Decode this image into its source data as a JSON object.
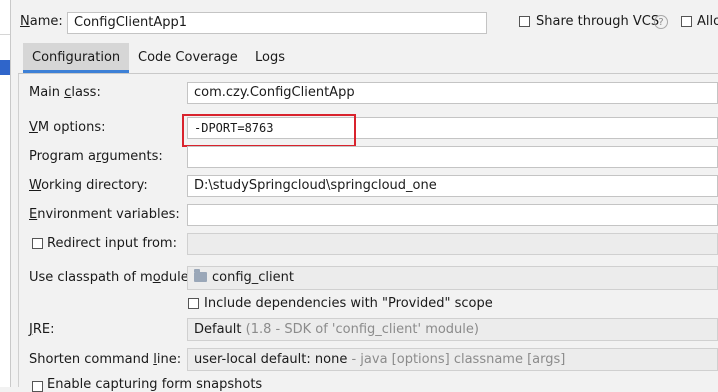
{
  "header": {
    "name_label": "Name:",
    "name_value": "ConfigClientApp1",
    "share_vcs_label": "Share through VCS",
    "share_vcs_checked": false,
    "help_glyph": "?",
    "allow_label": "Allo"
  },
  "tabs": [
    {
      "label": "Configuration",
      "active": true
    },
    {
      "label": "Code Coverage",
      "active": false
    },
    {
      "label": "Logs",
      "active": false
    }
  ],
  "form": {
    "main_class_label": "Main class:",
    "main_class_value": "com.czy.ConfigClientApp",
    "vm_options_label": "VM options:",
    "vm_options_value": "-DPORT=8763",
    "program_args_label": "Program arguments:",
    "program_args_value": "",
    "working_dir_label": "Working directory:",
    "working_dir_value": "D:\\studySpringcloud\\springcloud_one",
    "env_vars_label": "Environment variables:",
    "env_vars_value": "",
    "redirect_label": "Redirect input from:",
    "redirect_checked": false,
    "classpath_label": "Use classpath of module:",
    "classpath_value": "config_client",
    "include_deps_label": "Include dependencies with \"Provided\" scope",
    "include_deps_checked": false,
    "jre_label": "JRE:",
    "jre_value": "Default",
    "jre_hint": "(1.8 - SDK of 'config_client' module)",
    "shorten_label": "Shorten command line:",
    "shorten_value": "user-local default: none",
    "shorten_hint": "- java [options] classname [args]",
    "snapshots_label": "Enable capturing form snapshots"
  },
  "colors": {
    "highlight": "#d9232d",
    "tab_accent": "#3d80d6",
    "selection_blue": "#2f65ca"
  }
}
